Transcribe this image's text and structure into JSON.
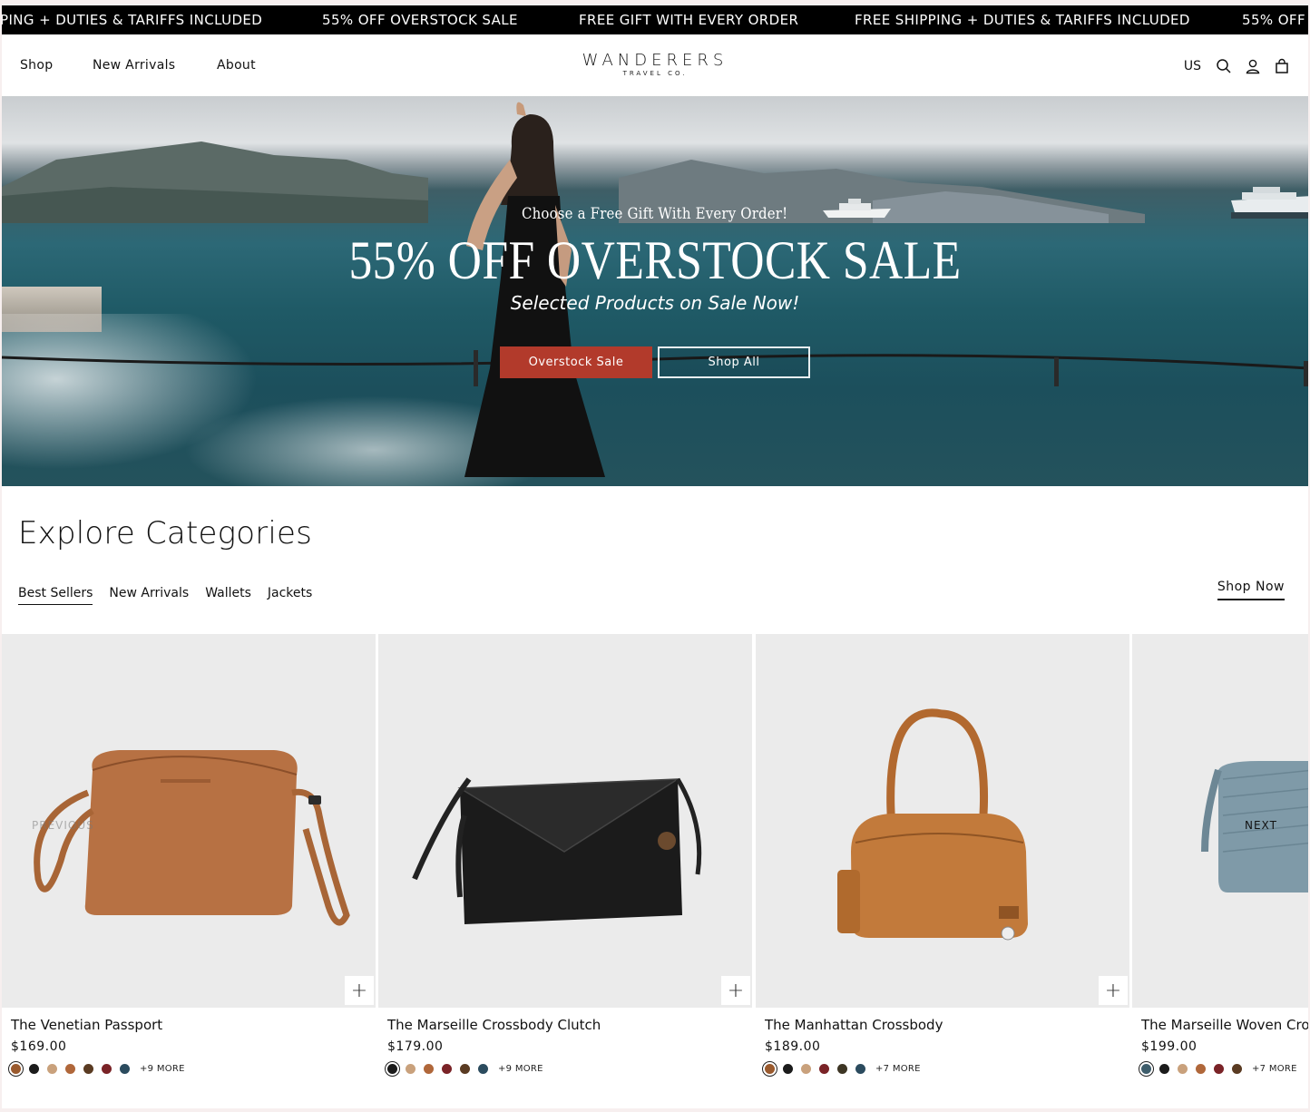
{
  "announcement": {
    "items": [
      "PING + DUTIES & TARIFFS INCLUDED",
      "55% OFF OVERSTOCK SALE",
      "FREE GIFT WITH EVERY ORDER",
      "FREE SHIPPING + DUTIES & TARIFFS INCLUDED",
      "55% OFF"
    ]
  },
  "header": {
    "nav": [
      "Shop",
      "New Arrivals",
      "About"
    ],
    "logo_name": "WANDERERS",
    "logo_sub": "TRAVEL CO.",
    "country": "US",
    "icons": [
      "search-icon",
      "account-icon",
      "cart-icon"
    ]
  },
  "hero": {
    "kicker": "Choose a Free Gift With Every Order!",
    "headline": "55% OFF OVERSTOCK SALE",
    "tagline": "Selected Products on Sale Now!",
    "primary_button": "Overstock Sale",
    "secondary_button": "Shop All",
    "accent_color": "#b23a2b"
  },
  "categories": {
    "title": "Explore Categories",
    "tabs": [
      "Best Sellers",
      "New Arrivals",
      "Wallets",
      "Jackets"
    ],
    "active_tab": "Best Sellers",
    "shop_now": "Shop Now",
    "prev_label": "PREVIOUS",
    "next_label": "NEXT"
  },
  "products": [
    {
      "title": "The Venetian Passport",
      "price": "$169.00",
      "swatches": [
        "#9a5a2e",
        "#1b1b1b",
        "#c9a17c",
        "#b0673a",
        "#5a3b22",
        "#7a2327",
        "#2b4b5e"
      ],
      "more": "+9 MORE",
      "add_icon": "plus-icon"
    },
    {
      "title": "The Marseille Crossbody Clutch",
      "price": "$179.00",
      "swatches": [
        "#1b1b1b",
        "#c9a17c",
        "#b0673a",
        "#7a2327",
        "#5a3b22",
        "#2b4b5e"
      ],
      "more": "+9 MORE",
      "add_icon": "plus-icon"
    },
    {
      "title": "The Manhattan Crossbody",
      "price": "$189.00",
      "swatches": [
        "#9a5a2e",
        "#1b1b1b",
        "#c9a17c",
        "#7a2327",
        "#3d3524",
        "#2b4b5e"
      ],
      "more": "+7 MORE",
      "add_icon": "plus-icon"
    },
    {
      "title": "The Marseille Woven Cro",
      "price": "$199.00",
      "swatches": [
        "#3e5d6b",
        "#1b1b1b",
        "#c9a17c",
        "#b0673a",
        "#7a2327",
        "#5a3b22"
      ],
      "more": "+7 MORE"
    }
  ]
}
